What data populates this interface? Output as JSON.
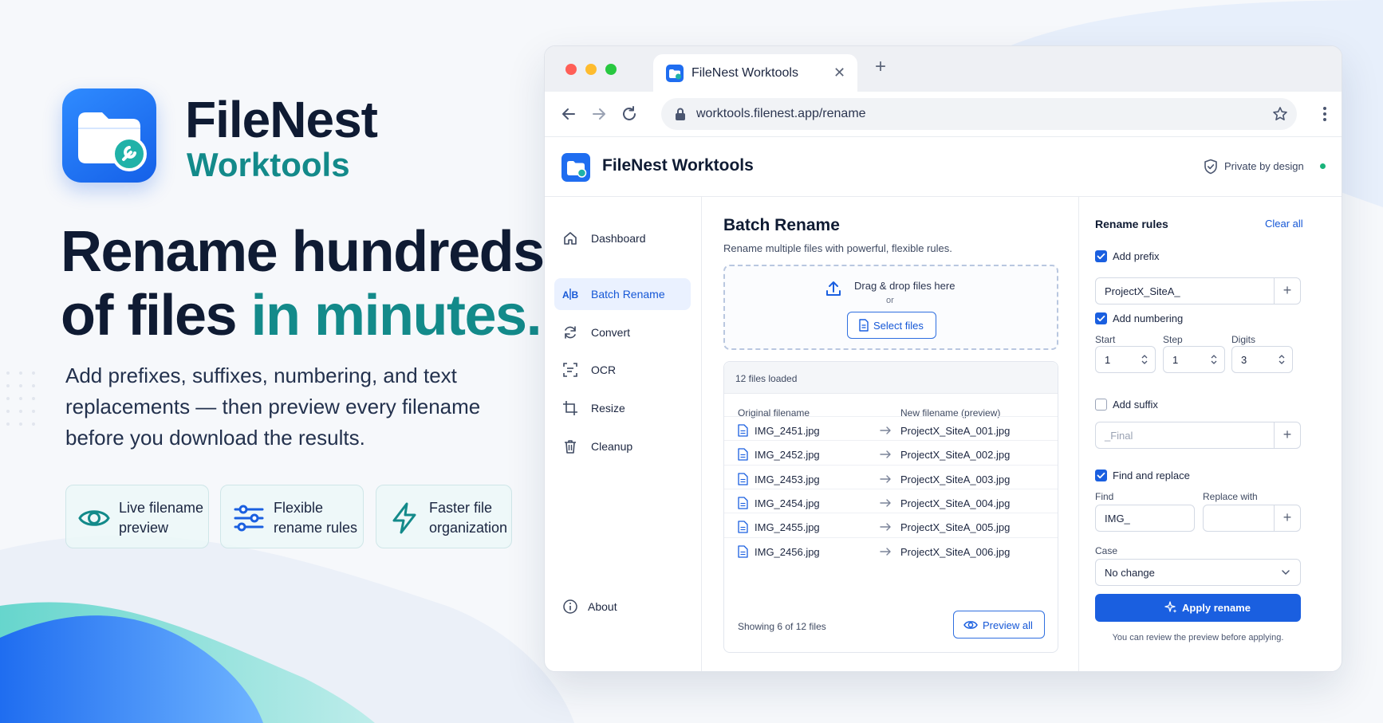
{
  "hero": {
    "brand_name": "FileNest",
    "brand_sub": "Worktools",
    "headline_line1": "Rename hundreds",
    "headline_line2_start": "of files ",
    "headline_accent": "in minutes.",
    "lead": "Add prefixes, suffixes, numbering, and text replacements — then preview every filename before you download the results.",
    "features": [
      {
        "line1": "Live filename",
        "line2": "preview",
        "icon": "eye-icon"
      },
      {
        "line1": "Flexible",
        "line2": "rename rules",
        "icon": "sliders-icon"
      },
      {
        "line1": "Faster file",
        "line2": "organization",
        "icon": "lightning-icon"
      }
    ]
  },
  "browser": {
    "tab_title": "FileNest Worktools",
    "tab_close": "✕",
    "new_tab": "+",
    "url": "worktools.filenest.app/rename"
  },
  "app": {
    "title": "FileNest Worktools",
    "private_label": "Private by design",
    "sidebar": [
      {
        "label": "Dashboard",
        "icon": "home-icon"
      },
      {
        "label": "Batch Rename",
        "icon": "ab-rename-icon"
      },
      {
        "label": "Convert",
        "icon": "refresh-icon"
      },
      {
        "label": "OCR",
        "icon": "scan-text-icon"
      },
      {
        "label": "Resize",
        "icon": "crop-icon"
      },
      {
        "label": "Cleanup",
        "icon": "trash-icon"
      }
    ],
    "about_label": "About",
    "main": {
      "title": "Batch Rename",
      "subtitle": "Rename multiple files with powerful, flexible rules.",
      "drop_text": "Drag & drop files here",
      "drop_or": "or",
      "select_label": "Select files",
      "loaded": "12 files loaded",
      "col_original": "Original filename",
      "col_new": "New filename (preview)",
      "rows": [
        {
          "orig": "IMG_2451.jpg",
          "new": "ProjectX_SiteA_001.jpg"
        },
        {
          "orig": "IMG_2452.jpg",
          "new": "ProjectX_SiteA_002.jpg"
        },
        {
          "orig": "IMG_2453.jpg",
          "new": "ProjectX_SiteA_003.jpg"
        },
        {
          "orig": "IMG_2454.jpg",
          "new": "ProjectX_SiteA_004.jpg"
        },
        {
          "orig": "IMG_2455.jpg",
          "new": "ProjectX_SiteA_005.jpg"
        },
        {
          "orig": "IMG_2456.jpg",
          "new": "ProjectX_SiteA_006.jpg"
        }
      ],
      "showing": "Showing 6 of 12 files",
      "preview_label": "Preview all"
    },
    "rules": {
      "title": "Rename rules",
      "clear_label": "Clear all",
      "prefix_label": "Add prefix",
      "prefix_checked": true,
      "prefix_value": "ProjectX_SiteA_",
      "numbering_label": "Add numbering",
      "numbering_checked": true,
      "start_label": "Start",
      "start_value": "1",
      "step_label": "Step",
      "step_value": "1",
      "digits_label": "Digits",
      "digits_value": "3",
      "suffix_label": "Add suffix",
      "suffix_checked": false,
      "suffix_placeholder": "_Final",
      "find_replace_label": "Find and replace",
      "find_replace_checked": true,
      "find_label": "Find",
      "find_value": "IMG_",
      "replace_label": "Replace with",
      "replace_value": "",
      "case_label": "Case",
      "case_value": "No change",
      "plus": "+",
      "apply_label": "Apply rename",
      "apply_note": "You can review the preview before applying."
    }
  },
  "colors": {
    "accent_blue": "#1a5fe0",
    "accent_teal": "#138a8a",
    "text_dark": "#0f1b33"
  }
}
